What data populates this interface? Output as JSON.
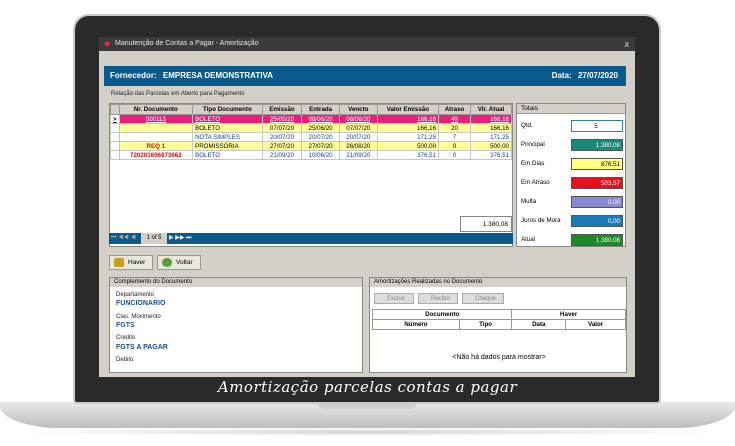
{
  "window": {
    "title": "Manutenção de Contas a Pagar - Amortização",
    "close": "x"
  },
  "supplier": {
    "label": "Fornecedor:",
    "name": "EMPRESA DEMONSTRATIVA",
    "date_label": "Data:",
    "date": "27/07/2020"
  },
  "installments_group": "Relação das Parcelas em Aberto para Pagamento",
  "grid": {
    "columns": [
      "Nr. Documento",
      "Tipo Documento",
      "Emissão",
      "Entrada",
      "Vencto",
      "Valor Emissão",
      "Atraso",
      "Vlr. Atual"
    ],
    "rows": [
      {
        "marker": ">",
        "doc": "000115",
        "type": "BOLETO",
        "emissao": "25/05/20",
        "entrada": "08/06/20",
        "vencto": "08/06/20",
        "valor": "166,16",
        "atraso": "49",
        "atual": "166,16",
        "style": "selected"
      },
      {
        "marker": "",
        "doc": "",
        "type": "BOLETO",
        "emissao": "07/07/20",
        "entrada": "25/06/20",
        "vencto": "07/07/20",
        "valor": "166,16",
        "atraso": "20",
        "atual": "166,16",
        "style": "yellow"
      },
      {
        "marker": "",
        "doc": "",
        "type": "NOTA SIMPLES",
        "emissao": "20/07/20",
        "entrada": "20/07/20",
        "vencto": "20/07/20",
        "valor": "171,25",
        "atraso": "7",
        "atual": "171,25",
        "style": "blue"
      },
      {
        "marker": "",
        "doc": "REQ 1",
        "type": "PROMISSÓRIA",
        "emissao": "27/07/20",
        "entrada": "27/07/20",
        "vencto": "26/08/20",
        "valor": "500,00",
        "atraso": "0",
        "atual": "500,00",
        "style": "yellow"
      },
      {
        "marker": "",
        "doc": "720201696873662",
        "type": "BOLETO",
        "emissao": "21/09/20",
        "entrada": "10/06/20",
        "vencto": "21/09/20",
        "valor": "376,51",
        "atraso": "0",
        "atual": "376,51",
        "style": "white"
      }
    ],
    "total": "1.380,08"
  },
  "pager": {
    "nav_left": "⏮ ◀◀ ◀",
    "page": "1 of 5",
    "nav_right": "▶ ▶▶ ⏭"
  },
  "totals": {
    "title": "Totais",
    "items": [
      {
        "label": "Qtd.",
        "value": "5",
        "color": "#ffffff",
        "text": "#000000"
      },
      {
        "label": "Principal",
        "value": "1.380,08",
        "color": "#1a8a7a",
        "text": "#ffffff"
      },
      {
        "label": "Em Dias",
        "value": "876,51",
        "color": "#ffff80",
        "text": "#000000"
      },
      {
        "label": "Em Atraso",
        "value": "503,57",
        "color": "#e81020",
        "text": "#ffffff"
      },
      {
        "label": "Multa",
        "value": "0,00",
        "color": "#8a8ad0",
        "text": "#ffffff"
      },
      {
        "label": "Juros de Mora",
        "value": "0,00",
        "color": "#1a7ab8",
        "text": "#ffffff"
      },
      {
        "label": "Atual",
        "value": "1.380,08",
        "color": "#1a8a2a",
        "text": "#ffffff"
      }
    ]
  },
  "buttons": {
    "haver": "Haver",
    "voltar": "Voltar"
  },
  "document": {
    "title": "Complemento do Documento",
    "fields": [
      {
        "label": "Departamento",
        "value": "FUNCIONARIO"
      },
      {
        "label": "Clas. Movimento",
        "value": "FGTS"
      },
      {
        "label": "Credito",
        "value": "FGTS A PAGAR"
      },
      {
        "label": "Debito",
        "value": ""
      }
    ]
  },
  "amortizations": {
    "title": "Amortizações Realizadas no Documento",
    "buttons": [
      "Excluir",
      "Recibo",
      "Cheque"
    ],
    "group_headers": [
      "Documento",
      "Haver"
    ],
    "columns": [
      "Número",
      "Tipo",
      "Data",
      "Valor"
    ],
    "empty": "<Não há dados para mostrar>"
  },
  "caption": "Amortização parcelas contas a pagar",
  "colors": {
    "brand_blue": "#0a5b8c",
    "selected_row": "#e8207c",
    "yellow_row": "#ffff99"
  }
}
